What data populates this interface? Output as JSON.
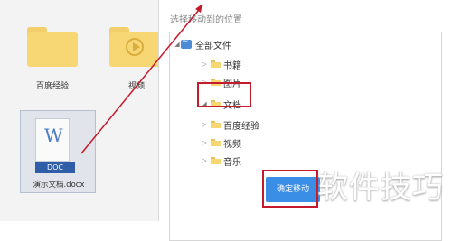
{
  "files": {
    "folders": [
      {
        "label": "百度经验"
      },
      {
        "label": "视频"
      }
    ],
    "doc": {
      "icon_letter": "W",
      "badge": "DOC",
      "name": "演示文档.docx"
    }
  },
  "dialog": {
    "title": "选择移动到的位置",
    "tree": {
      "root": {
        "label": "全部文件"
      },
      "children": [
        {
          "label": "书籍"
        },
        {
          "label": "图片"
        },
        {
          "label": "文档"
        },
        {
          "label": "百度经验"
        },
        {
          "label": "视频"
        },
        {
          "label": "音乐"
        }
      ]
    },
    "confirm_label": "确定移动"
  },
  "watermark": "软件技巧",
  "colors": {
    "annotation_red": "#c51a2b",
    "folder_yellow": "#f7d774",
    "primary_blue": "#3b8ee6"
  }
}
